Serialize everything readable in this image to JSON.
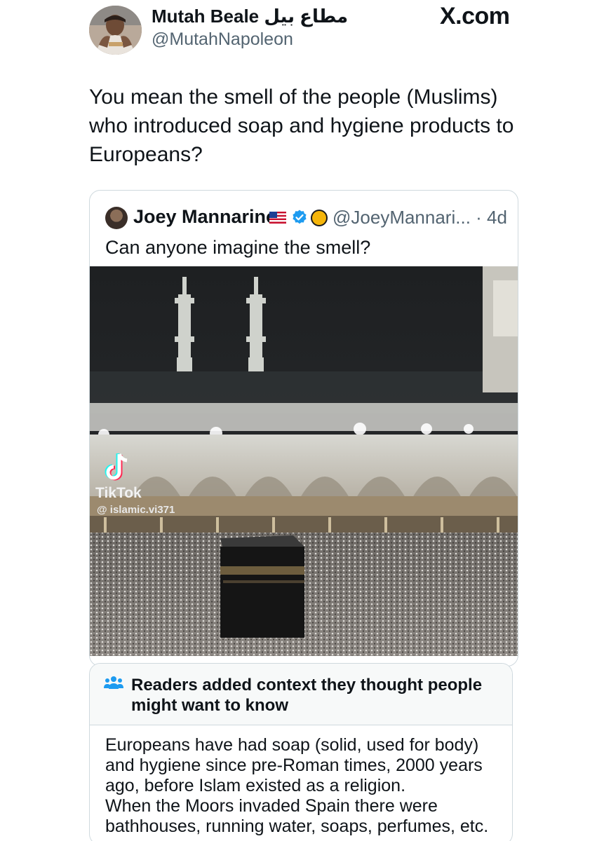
{
  "brand": "X.com",
  "author": {
    "name": "Mutah Beale مطاع بيل",
    "handle": "@MutahNapoleon"
  },
  "tweet": {
    "lines": [
      "You mean the smell of the people (Muslims)",
      "who introduced soap and hygiene products to",
      "Europeans?"
    ]
  },
  "quoted": {
    "name": "Joey Mannarino",
    "handle_time": "@JoeyMannari... · 4d",
    "text": "Can anyone imagine the smell?",
    "media": {
      "watermark": "TikTok",
      "watermark_handle": "@ islamic.vi371"
    }
  },
  "community_note": {
    "title_lines": [
      "Readers added context they thought people",
      "might want to know"
    ],
    "body_lines": [
      "Europeans have had soap (solid, used for body)",
      "and hygiene since pre-Roman times, 2000 years",
      "ago, before Islam existed as a religion.",
      "When the Moors invaded Spain there were",
      "bathhouses, running water, soaps, perfumes, etc."
    ]
  },
  "colors": {
    "text": "#0f1419",
    "secondary": "#536471",
    "verified": "#1d9bf0",
    "border": "#cfd9de",
    "note_icon": "#1d9bf0"
  },
  "icons": [
    "avatar",
    "us-flag-icon",
    "verified-badge-icon",
    "gold-circle-icon",
    "tiktok-logo-icon",
    "people-icon"
  ]
}
